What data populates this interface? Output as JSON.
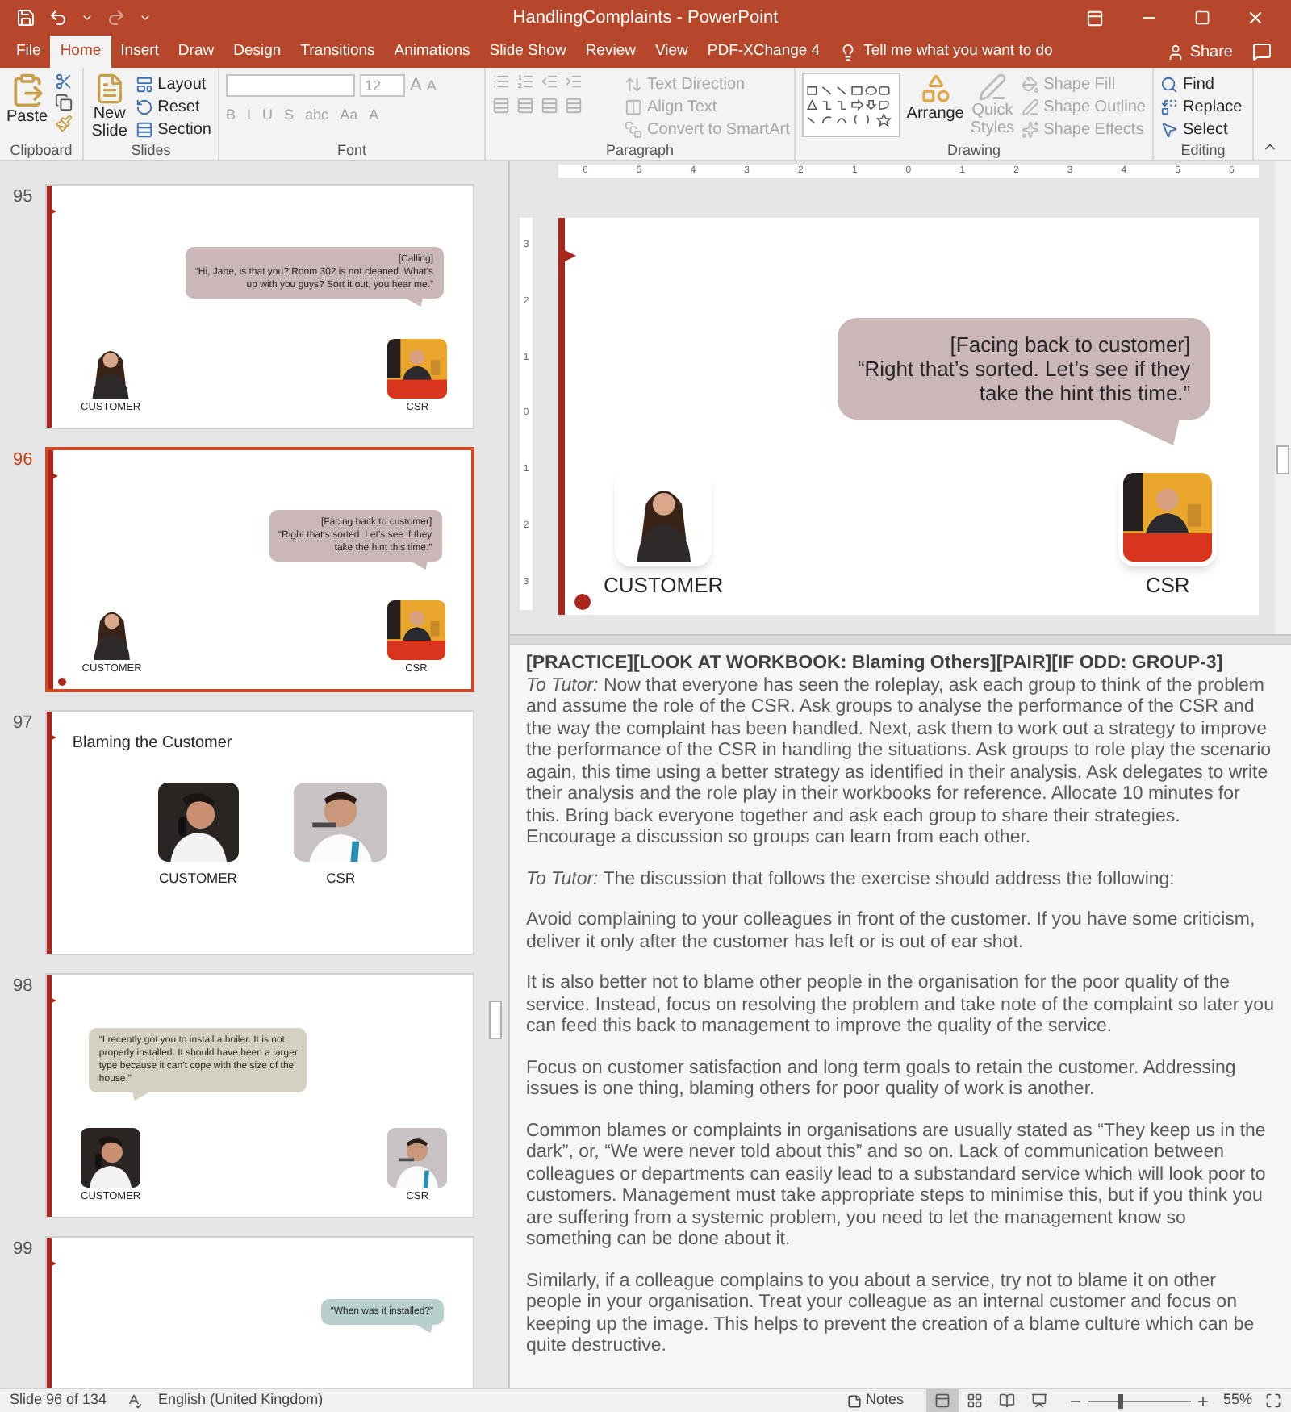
{
  "title_bar": {
    "title": "HandlingComplaints - PowerPoint"
  },
  "tabs": [
    {
      "label": "File",
      "selected": false
    },
    {
      "label": "Home",
      "selected": true
    },
    {
      "label": "Insert",
      "selected": false
    },
    {
      "label": "Draw",
      "selected": false
    },
    {
      "label": "Design",
      "selected": false
    },
    {
      "label": "Transitions",
      "selected": false
    },
    {
      "label": "Animations",
      "selected": false
    },
    {
      "label": "Slide Show",
      "selected": false
    },
    {
      "label": "Review",
      "selected": false
    },
    {
      "label": "View",
      "selected": false
    },
    {
      "label": "PDF-XChange 4",
      "selected": false
    }
  ],
  "tell_me": {
    "placeholder": "Tell me what you want to do"
  },
  "share": "Share",
  "ribbon": {
    "clipboard": {
      "label": "Clipboard",
      "paste": "Paste"
    },
    "slides": {
      "label": "Slides",
      "new_slide": "New Slide",
      "items": [
        {
          "label": "Layout",
          "disabled": false
        },
        {
          "label": "Reset",
          "disabled": false
        },
        {
          "label": "Section",
          "disabled": false
        }
      ]
    },
    "font": {
      "label": "Font",
      "font_size": "12",
      "size_buttons": [
        "A",
        "A"
      ],
      "buttons": [
        "B",
        "I",
        "U",
        "S",
        "abc",
        "Aa",
        "A"
      ]
    },
    "paragraph": {
      "label": "Paragraph",
      "items": [
        {
          "label": "Text Direction",
          "disabled": true
        },
        {
          "label": "Align Text",
          "disabled": true
        },
        {
          "label": "Convert to SmartArt",
          "disabled": true
        }
      ]
    },
    "drawing": {
      "label": "Drawing",
      "arrange": "Arrange",
      "quick_styles": "Quick Styles",
      "items": [
        {
          "label": "Shape Fill",
          "disabled": true
        },
        {
          "label": "Shape Outline",
          "disabled": true
        },
        {
          "label": "Shape Effects",
          "disabled": true
        }
      ]
    },
    "editing": {
      "label": "Editing",
      "items": [
        {
          "label": "Find",
          "disabled": false
        },
        {
          "label": "Replace",
          "disabled": false
        },
        {
          "label": "Select",
          "disabled": false
        }
      ]
    }
  },
  "slides": [
    {
      "number": "95",
      "selected": false,
      "kind": "dialogue",
      "end_marker": false,
      "bubble": {
        "kind": "right",
        "color": "#cbb6b8",
        "lines": [
          "[Calling]",
          "“Hi, Jane, is that you? Room 302 is not cleaned. What’s",
          "up with you guys? Sort it out, you hear me.”"
        ]
      },
      "characters": [
        "CUSTOMER",
        "CSR"
      ]
    },
    {
      "number": "96",
      "selected": true,
      "kind": "dialogue",
      "end_marker": true,
      "bubble": {
        "kind": "right",
        "color": "#cbb6b8",
        "lines": [
          "[Facing back to customer]",
          "“Right that’s sorted. Let’s see if they",
          "take the hint this time.”"
        ]
      },
      "characters": [
        "CUSTOMER",
        "CSR"
      ]
    },
    {
      "number": "97",
      "selected": false,
      "kind": "title",
      "end_marker": false,
      "title": "Blaming the Customer",
      "characters": [
        "CUSTOMER",
        "CSR"
      ]
    },
    {
      "number": "98",
      "selected": false,
      "kind": "dialogue",
      "end_marker": false,
      "bubble": {
        "kind": "left",
        "color": "#d5d1c0",
        "lines": [
          "“I recently got you to install a boiler. It is not",
          "properly installed. It should have been a larger",
          "type because it can’t cope with the size of the",
          "house.”"
        ]
      },
      "characters": [
        "CUSTOMER",
        "CSR"
      ]
    },
    {
      "number": "99",
      "selected": false,
      "kind": "dialogue",
      "end_marker": false,
      "bubble": {
        "kind": "right",
        "color": "#b7cfcd",
        "lines": [
          "“When was it installed?”"
        ]
      }
    }
  ],
  "ruler": {
    "horizontal": [
      "6",
      "5",
      "4",
      "3",
      "2",
      "1",
      "0",
      "1",
      "2",
      "3",
      "4",
      "5",
      "6"
    ],
    "vertical": [
      "3",
      "2",
      "1",
      "0",
      "1",
      "2",
      "3"
    ]
  },
  "current_slide": {
    "kind": "dialogue",
    "end_marker": true,
    "bubble": {
      "kind": "right",
      "color": "#cbb6b8",
      "lines": [
        "[Facing back to customer]",
        "“Right that’s sorted. Let’s see if they",
        "take the hint this time.”"
      ]
    },
    "characters": [
      "CUSTOMER",
      "CSR"
    ]
  },
  "notes": [
    {
      "kind": "heading",
      "text": "[PRACTICE][LOOK AT WORKBOOK: Blaming Others][PAIR][IF ODD: GROUP-3]"
    },
    {
      "kind": "body",
      "text": "*To Tutor:* Now that everyone has seen the roleplay, ask each group to think of the problem and assume the role of the CSR. Ask groups to analyse the performance of the CSR and the way the complaint has been handled. Next, ask them to work out a strategy to improve the performance of the CSR in handling the situations. Ask groups to role play the scenario again, this time using a better strategy as identified in their analysis. Ask delegates to write their analysis and the role play in their workbooks for reference. Allocate 10 minutes for this. Bring back everyone together and ask each group to share their strategies. Encourage a discussion so groups can learn from each other."
    },
    {
      "kind": "body",
      "text": "*To Tutor:* The discussion that follows the exercise should address the following:"
    },
    {
      "kind": "body",
      "text": "Avoid complaining to your colleagues in front of the customer. If you have some criticism, deliver it only after the customer has left or is out of ear shot."
    },
    {
      "kind": "body",
      "text": "It is also better not to blame other people in the organisation for the poor quality of the service. Instead, focus on resolving the problem and take note of the complaint so later you can feed this back to management to improve the quality of the service."
    },
    {
      "kind": "body",
      "text": "Focus on customer satisfaction and long term goals to retain the customer. Addressing issues is one thing, blaming others for poor quality of work is another."
    },
    {
      "kind": "body",
      "text": "Common blames or complaints in organisations are usually stated as “They keep us in the dark”, or, “We were never told about this” and so on. Lack of communication between colleagues or departments can easily lead to a substandard service which will look poor to customers. Management must take appropriate steps to minimise this, but if you think you are suffering from a systemic problem, you need to let the management know so something can be done about it."
    },
    {
      "kind": "body",
      "text": "Similarly, if a colleague complains to you about a service, try not to blame it on other people in your organisation. Treat your colleague as an internal customer and focus on keeping up the image. This helps to prevent the creation of a blame culture which can be quite destructive."
    }
  ],
  "status_bar": {
    "slide": "Slide 96 of 134",
    "language": "English (United Kingdom)",
    "notes": "Notes",
    "views": [
      {
        "kind": "normal",
        "selected": true
      },
      {
        "kind": "sorter",
        "selected": false
      },
      {
        "kind": "reading",
        "selected": false
      },
      {
        "kind": "slideshow",
        "selected": false
      }
    ],
    "zoom": {
      "level": 0.3,
      "reading": "55%"
    }
  }
}
